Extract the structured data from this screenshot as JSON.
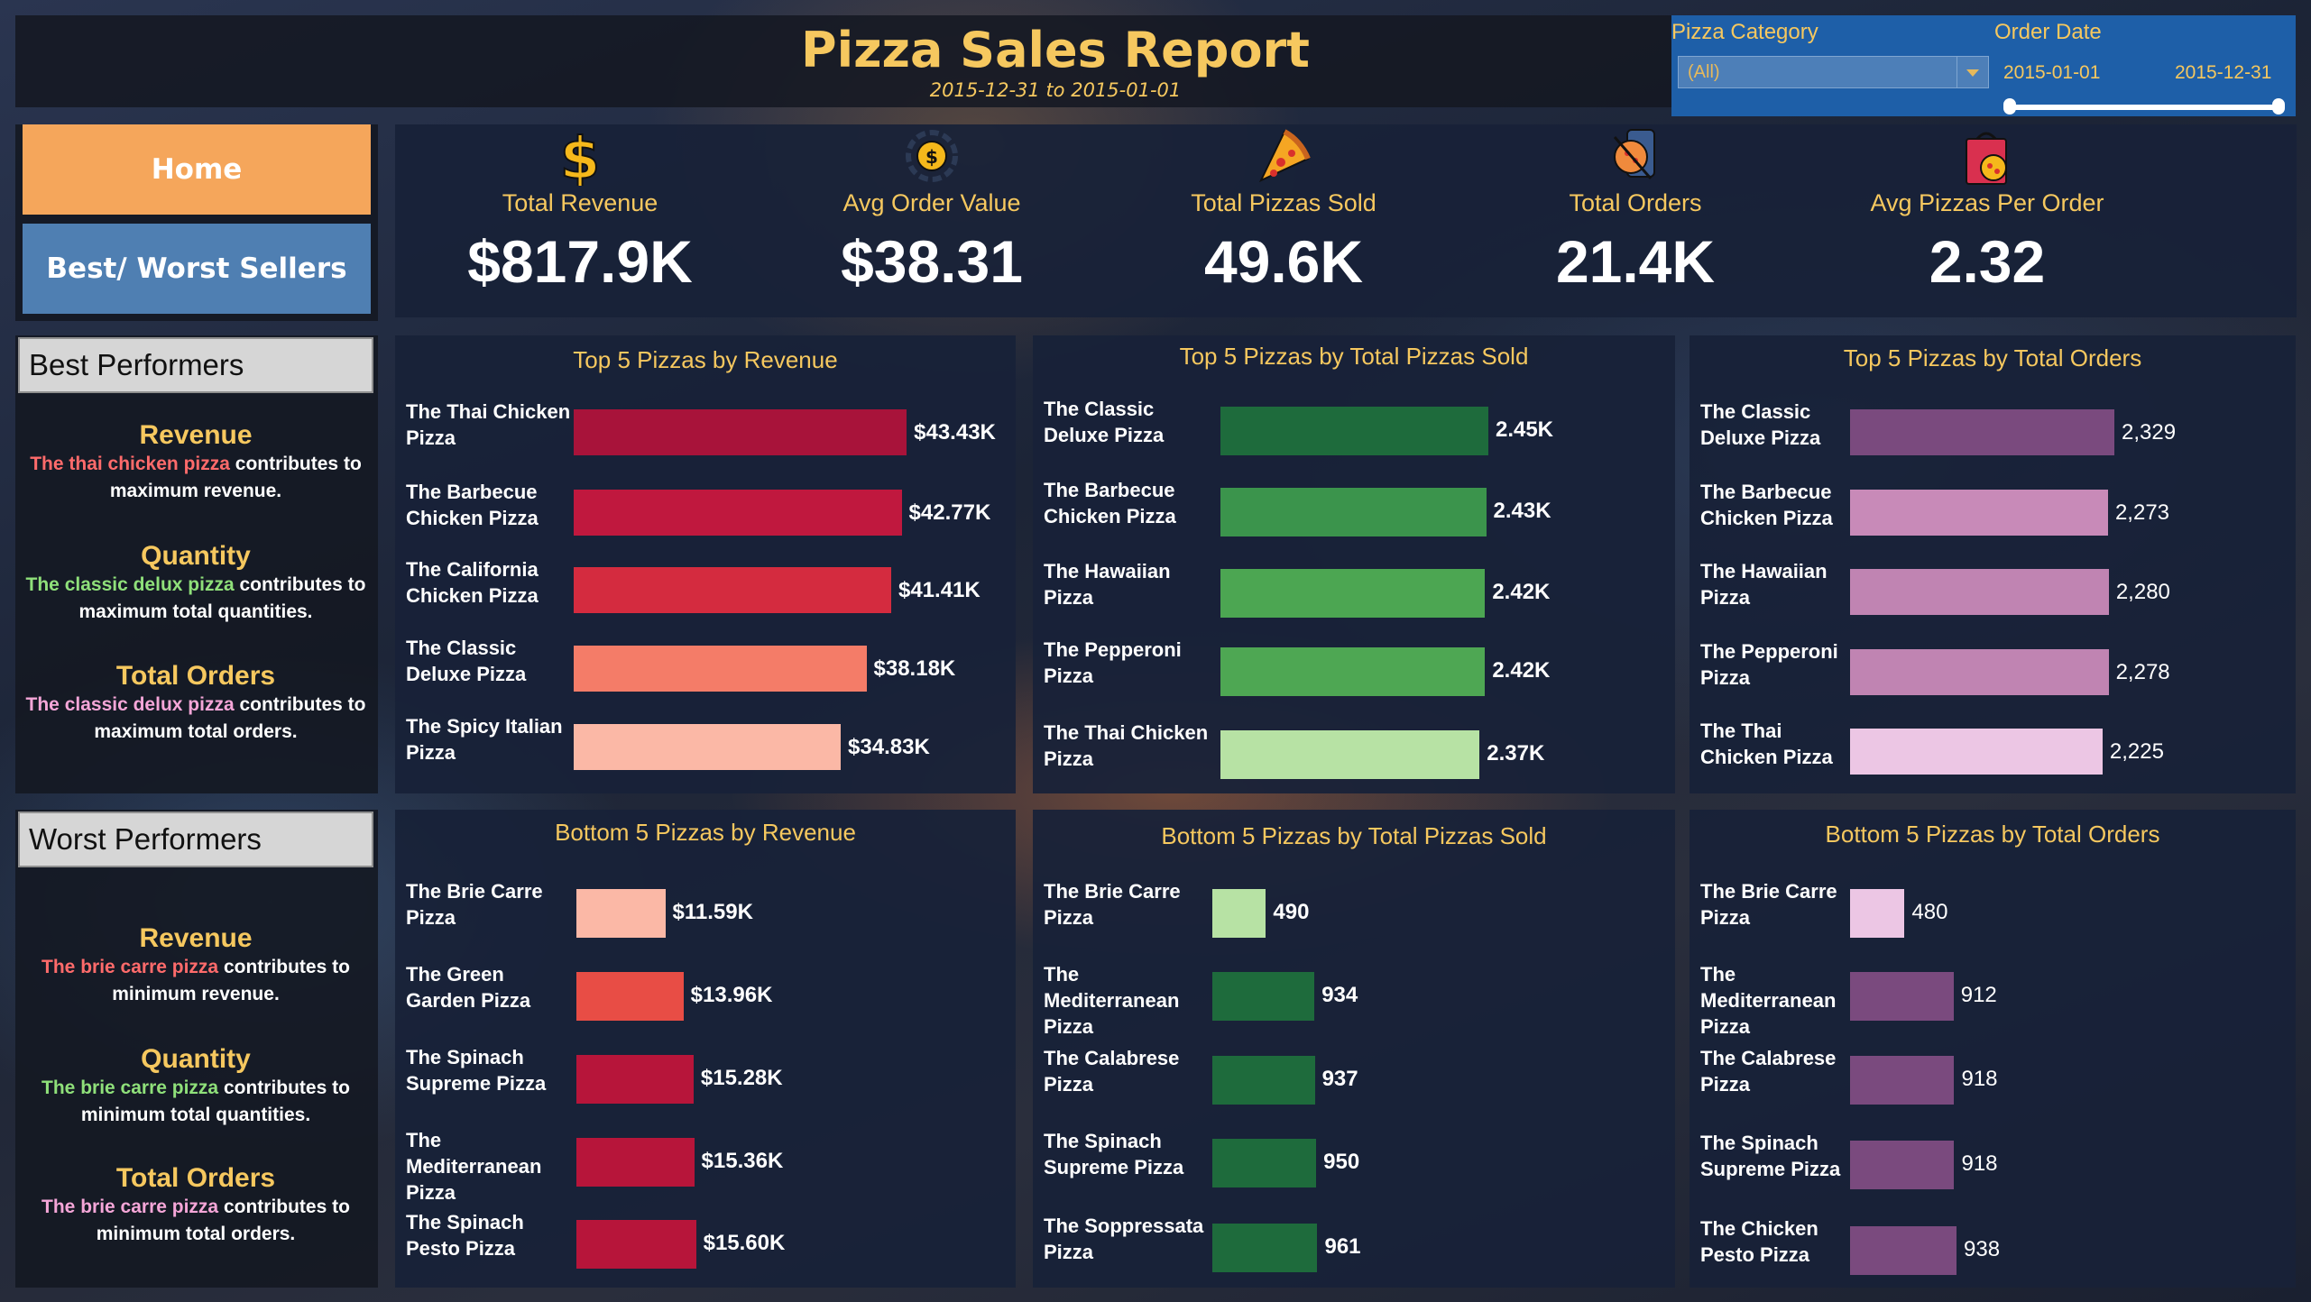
{
  "header": {
    "title": "Pizza Sales Report",
    "subtitle": "2015-12-31 to 2015-01-01"
  },
  "filters": {
    "category_label": "Pizza Category",
    "category_value": "(All)",
    "date_label": "Order Date",
    "date_start": "2015-01-01",
    "date_end": "2015-12-31"
  },
  "nav": {
    "home": "Home",
    "best_worst": "Best/ Worst Sellers"
  },
  "kpis": [
    {
      "label": "Total Revenue",
      "value": "$817.9K",
      "icon": "dollar-icon"
    },
    {
      "label": "Avg Order Value",
      "value": "$38.31",
      "icon": "coin-icon"
    },
    {
      "label": "Total Pizzas Sold",
      "value": "49.6K",
      "icon": "pizza-slice-icon"
    },
    {
      "label": "Total Orders",
      "value": "21.4K",
      "icon": "pizza-order-icon"
    },
    {
      "label": "Avg Pizzas Per Order",
      "value": "2.32",
      "icon": "pizza-bag-icon"
    }
  ],
  "best": {
    "heading": "Best Performers",
    "items": [
      {
        "title": "Revenue",
        "highlight": "The thai chicken pizza",
        "rest": " contributes to maximum revenue.",
        "color": "#ff6b6b"
      },
      {
        "title": "Quantity",
        "highlight": "The classic delux pizza",
        "rest": " contributes to maximum total quantities.",
        "color": "#8fe07a"
      },
      {
        "title": "Total Orders",
        "highlight": "The classic delux pizza",
        "rest": " contributes to maximum total orders.",
        "color": "#f5a6d8"
      }
    ]
  },
  "worst": {
    "heading": "Worst Performers",
    "items": [
      {
        "title": "Revenue",
        "highlight": "The brie carre pizza",
        "rest": " contributes to minimum revenue.",
        "color": "#ff6b6b"
      },
      {
        "title": "Quantity",
        "highlight": "The brie carre pizza",
        "rest": " contributes to minimum total quantities.",
        "color": "#8fe07a"
      },
      {
        "title": "Total Orders",
        "highlight": "The brie carre pizza",
        "rest": " contributes to minimum total orders.",
        "color": "#f5a6d8"
      }
    ]
  },
  "chart_data": [
    {
      "type": "bar",
      "orientation": "horizontal",
      "title": "Top 5 Pizzas by Revenue",
      "categories": [
        "The Thai Chicken Pizza",
        "The Barbecue Chicken Pizza",
        "The California Chicken Pizza",
        "The Classic Deluxe Pizza",
        "The Spicy Italian Pizza"
      ],
      "values": [
        43430,
        42770,
        41410,
        38180,
        34830
      ],
      "labels": [
        "$43.43K",
        "$42.77K",
        "$41.41K",
        "$38.18K",
        "$34.83K"
      ],
      "colors": [
        "#a8133a",
        "#c0183e",
        "#d42b3f",
        "#f47c68",
        "#fbb8a6"
      ]
    },
    {
      "type": "bar",
      "orientation": "horizontal",
      "title": "Top 5 Pizzas by Total Pizzas Sold",
      "categories": [
        "The Classic Deluxe Pizza",
        "The Barbecue Chicken Pizza",
        "The Hawaiian Pizza",
        "The Pepperoni Pizza",
        "The Thai Chicken Pizza"
      ],
      "values": [
        2450,
        2430,
        2420,
        2420,
        2370
      ],
      "labels": [
        "2.45K",
        "2.43K",
        "2.42K",
        "2.42K",
        "2.37K"
      ],
      "colors": [
        "#1e6b3c",
        "#3b944c",
        "#4ca652",
        "#4ea753",
        "#b7e2a4"
      ]
    },
    {
      "type": "bar",
      "orientation": "horizontal",
      "title": "Top 5 Pizzas by Total Orders",
      "categories": [
        "The Classic Deluxe Pizza",
        "The Barbecue Chicken Pizza",
        "The Hawaiian Pizza",
        "The Pepperoni Pizza",
        "The Thai Chicken Pizza"
      ],
      "values": [
        2329,
        2273,
        2280,
        2278,
        2225
      ],
      "labels": [
        "2,329",
        "2,273",
        "2,280",
        "2,278",
        "2,225"
      ],
      "colors": [
        "#7a4a7e",
        "#c88ab8",
        "#c084b2",
        "#c084b2",
        "#ecc6e4"
      ]
    },
    {
      "type": "bar",
      "orientation": "horizontal",
      "title": "Bottom 5 Pizzas by Revenue",
      "categories": [
        "The Brie Carre Pizza",
        "The Green Garden Pizza",
        "The Spinach Supreme Pizza",
        "The Mediterranean Pizza",
        "The Spinach Pesto Pizza"
      ],
      "values": [
        11590,
        13960,
        15280,
        15360,
        15600
      ],
      "labels": [
        "$11.59K",
        "$13.96K",
        "$15.28K",
        "$15.36K",
        "$15.60K"
      ],
      "colors": [
        "#fbb8a6",
        "#e84d45",
        "#b7153a",
        "#b7153a",
        "#b7153a"
      ]
    },
    {
      "type": "bar",
      "orientation": "horizontal",
      "title": "Bottom 5 Pizzas by Total Pizzas Sold",
      "categories": [
        "The Brie Carre Pizza",
        "The Mediterranean Pizza",
        "The Calabrese Pizza",
        "The Spinach Supreme Pizza",
        "The Soppressata Pizza"
      ],
      "values": [
        490,
        934,
        937,
        950,
        961
      ],
      "labels": [
        "490",
        "934",
        "937",
        "950",
        "961"
      ],
      "colors": [
        "#b7e2a4",
        "#1e6b3c",
        "#1e6b3c",
        "#1e6b3c",
        "#1e6b3c"
      ]
    },
    {
      "type": "bar",
      "orientation": "horizontal",
      "title": "Bottom 5 Pizzas by Total Orders",
      "categories": [
        "The Brie Carre Pizza",
        "The Mediterranean Pizza",
        "The Calabrese Pizza",
        "The Spinach Supreme Pizza",
        "The Chicken Pesto Pizza"
      ],
      "values": [
        480,
        912,
        918,
        918,
        938
      ],
      "labels": [
        "480",
        "912",
        "918",
        "918",
        "938"
      ],
      "colors": [
        "#ecc6e4",
        "#7a4a7e",
        "#7a4a7e",
        "#7a4a7e",
        "#7a4a7e"
      ]
    }
  ]
}
